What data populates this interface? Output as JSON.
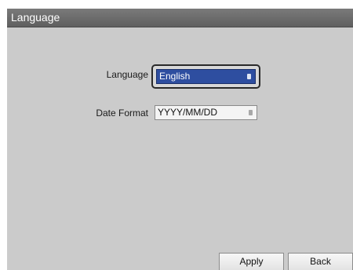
{
  "window": {
    "title": "Language"
  },
  "form": {
    "language_label": "Language",
    "language_value": "English",
    "date_format_label": "Date Format",
    "date_format_value": "YYYY/MM/DD"
  },
  "buttons": {
    "apply": "Apply",
    "back": "Back"
  }
}
